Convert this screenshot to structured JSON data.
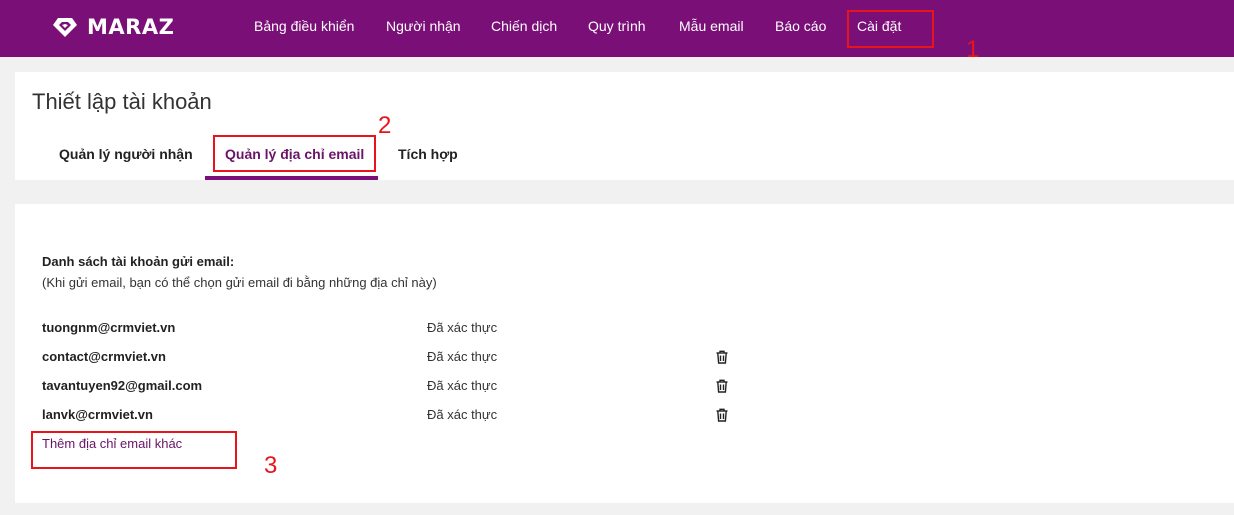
{
  "app": {
    "name": "MARAZ"
  },
  "nav": {
    "items": [
      {
        "label": "Bảng điều khiển"
      },
      {
        "label": "Người nhận"
      },
      {
        "label": "Chiến dịch"
      },
      {
        "label": "Quy trình"
      },
      {
        "label": "Mẫu email"
      },
      {
        "label": "Báo cáo"
      },
      {
        "label": "Cài đặt"
      }
    ]
  },
  "page": {
    "title": "Thiết lập tài khoản"
  },
  "tabs": [
    {
      "label": "Quản lý người nhận"
    },
    {
      "label": "Quản lý địa chỉ email",
      "active": true
    },
    {
      "label": "Tích hợp"
    }
  ],
  "section": {
    "title": "Danh sách tài khoản gửi email:",
    "subtitle": "(Khi gửi email, bạn có thể chọn gửi email đi bằng những địa chỉ này)"
  },
  "accounts": [
    {
      "email": "tuongnm@crmviet.vn",
      "status": "Đã xác thực",
      "deletable": false
    },
    {
      "email": "contact@crmviet.vn",
      "status": "Đã xác thực",
      "deletable": true,
      "icon": "trash-icon"
    },
    {
      "email": "tavantuyen92@gmail.com",
      "status": "Đã xác thực",
      "deletable": true,
      "icon": "trash-icon"
    },
    {
      "email": "lanvk@crmviet.vn",
      "status": "Đã xác thực",
      "deletable": true,
      "icon": "trash-icon"
    }
  ],
  "add_link": "Thêm địa chỉ email khác",
  "annotations": [
    "1",
    "2",
    "3"
  ],
  "colors": {
    "brand": "#7a0f78",
    "annotation": "#e8141b",
    "link": "#6a1468"
  }
}
